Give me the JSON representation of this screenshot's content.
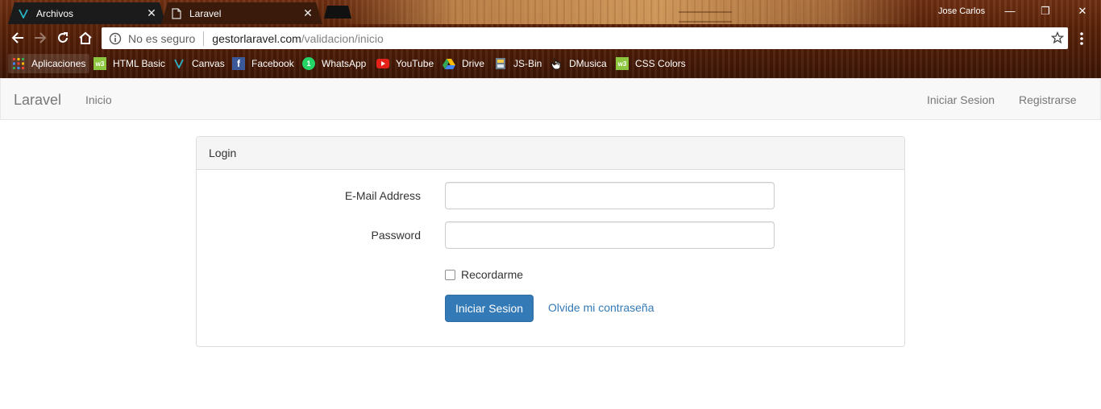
{
  "browser": {
    "tabs": [
      {
        "title": "Archivos",
        "close": "✕"
      },
      {
        "title": "Laravel",
        "close": "✕"
      }
    ],
    "user_name": "Jose Carlos",
    "window_buttons": {
      "minimize": "—",
      "restore": "❐",
      "close": "✕"
    },
    "omnibox": {
      "security_label": "No es seguro",
      "url_host": "gestorlaravel.com",
      "url_path": "/validacion/inicio"
    },
    "bookmarks": [
      {
        "label": "Aplicaciones",
        "icon": "apps-grid-icon"
      },
      {
        "label": "HTML Basic",
        "icon": "w3schools-icon"
      },
      {
        "label": "Canvas",
        "icon": "canvas-v-icon"
      },
      {
        "label": "Facebook",
        "icon": "facebook-icon"
      },
      {
        "label": "WhatsApp",
        "icon": "whatsapp-icon"
      },
      {
        "label": "YouTube",
        "icon": "youtube-icon"
      },
      {
        "label": "Drive",
        "icon": "drive-icon"
      },
      {
        "label": "JS-Bin",
        "icon": "jsbin-icon"
      },
      {
        "label": "DMusica",
        "icon": "hand-cursor-icon"
      },
      {
        "label": "CSS Colors",
        "icon": "w3schools-icon"
      }
    ]
  },
  "navbar": {
    "brand": "Laravel",
    "left_links": [
      "Inicio"
    ],
    "right_links": [
      "Iniciar Sesion",
      "Registrarse"
    ]
  },
  "login": {
    "heading": "Login",
    "email_label": "E-Mail Address",
    "email_value": "",
    "password_label": "Password",
    "password_value": "",
    "remember_label": "Recordarme",
    "remember_checked": false,
    "submit_label": "Iniciar Sesion",
    "forgot_label": "Olvide mi contraseña"
  },
  "colors": {
    "primary": "#337ab7",
    "navbar_bg": "#f8f8f8",
    "panel_heading_bg": "#f5f5f5"
  }
}
